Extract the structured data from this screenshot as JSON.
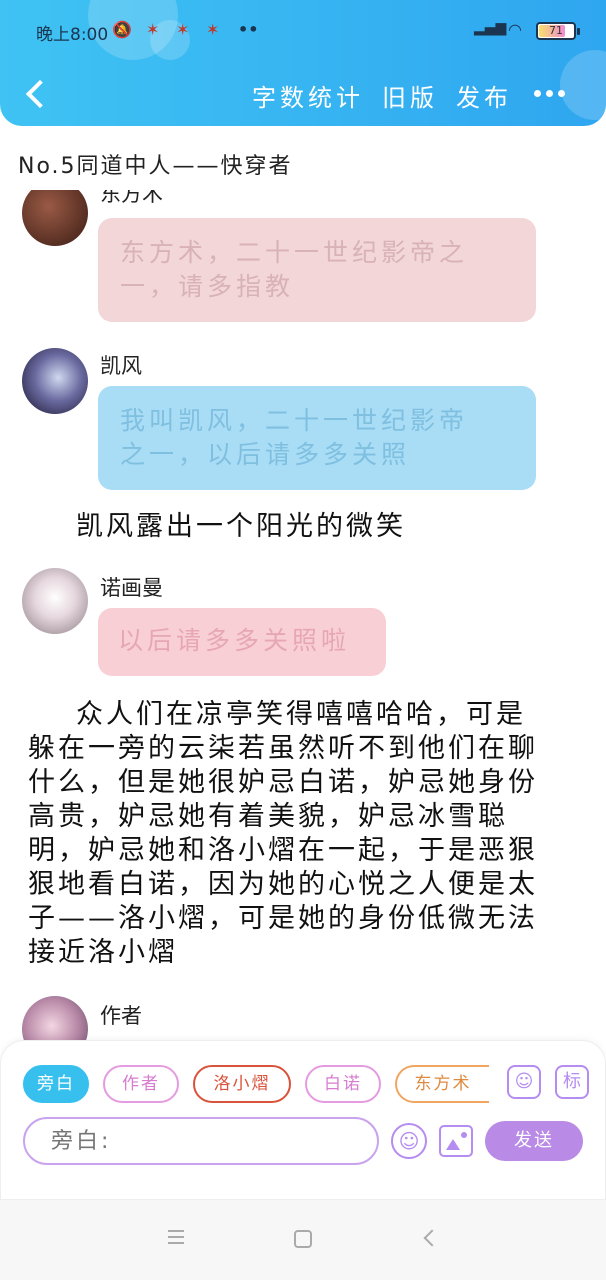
{
  "status_bar": {
    "time": "晚上8:00",
    "battery": "71"
  },
  "nav": {
    "word_count": "字数统计",
    "old_version": "旧版",
    "publish": "发布"
  },
  "chapter_title": "No.5同道中人——快穿者",
  "messages": [
    {
      "speaker": "东方术",
      "text_line1": "东方术，二十一世纪影帝之",
      "text_line2": "一，请多指教"
    },
    {
      "speaker": "凯风",
      "text_line1": "我叫凯风，二十一世纪影帝",
      "text_line2": "之一，以后请多多关照"
    },
    {
      "narration": "凯风露出一个阳光的微笑"
    },
    {
      "speaker": "诺画曼",
      "text_line1": "以后请多多关照啦"
    },
    {
      "narration_lines": [
        "众人们在凉亭笑得嘻嘻哈哈，可是",
        "躲在一旁的云柒若虽然听不到他们在聊",
        "什么，但是她很妒忌白诺，妒忌她身份",
        "高贵，妒忌她有着美貌，妒忌冰雪聪",
        "明，妒忌她和洛小熠在一起，于是恶狠",
        "狠地看白诺，因为她的心悦之人便是太",
        "子——洛小熠，可是她的身份低微无法",
        "接近洛小熠"
      ]
    },
    {
      "speaker": "作者"
    }
  ],
  "composer": {
    "roles": [
      "旁白",
      "作者",
      "洛小熠",
      "白诺",
      "东方术"
    ],
    "input_placeholder": "旁白:",
    "send_label": "发送",
    "mark_label": "标"
  },
  "colors": {
    "header": "#2fa6f0",
    "accent_purple": "#b98ae6",
    "active_role": "#37c0ee"
  }
}
